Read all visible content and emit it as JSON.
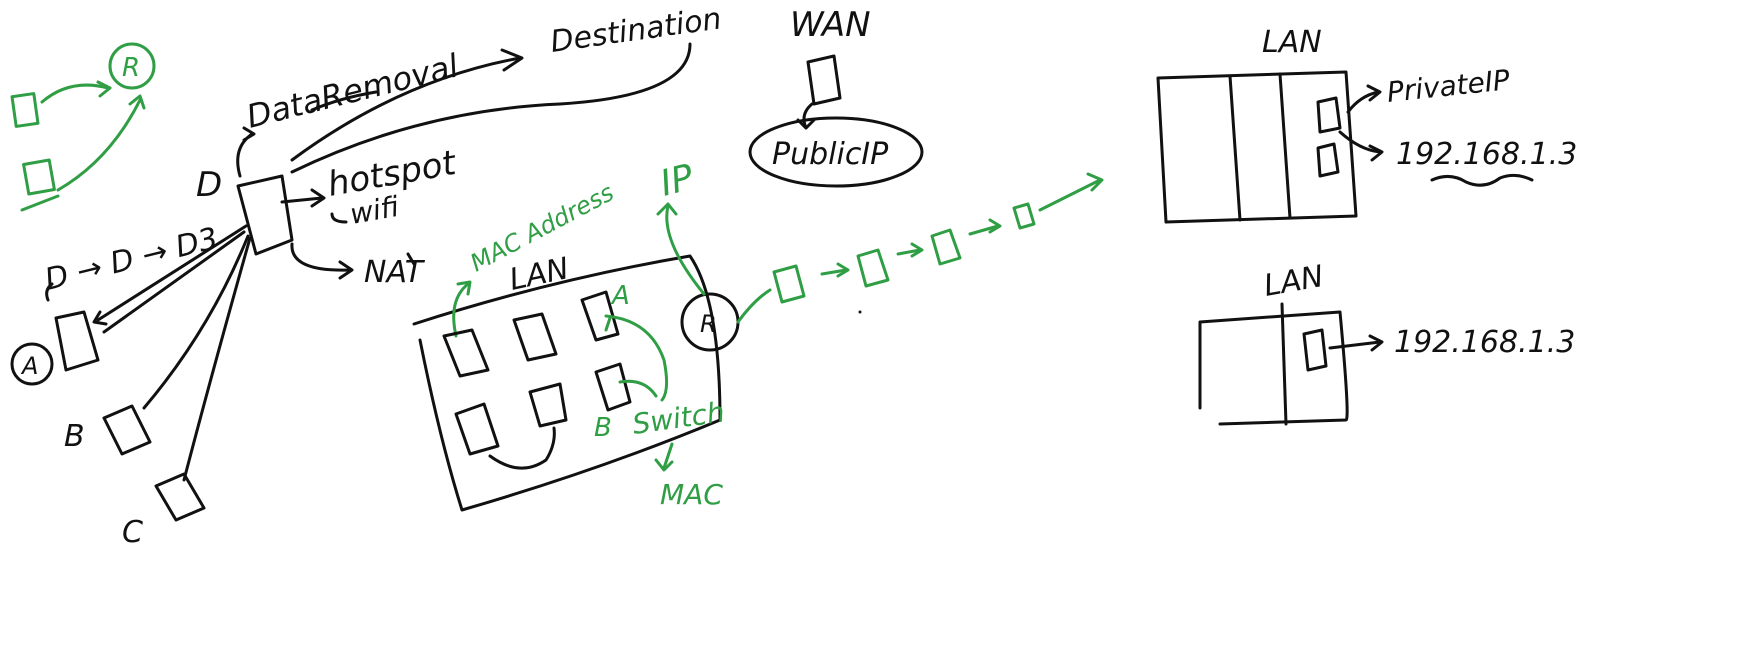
{
  "colors": {
    "black_ink": "#111111",
    "green_ink": "#2f9e44",
    "background": "#ffffff"
  },
  "labels": {
    "r_green": "R",
    "data_removal": "DataRemoval",
    "destination": "Destination",
    "d_top": "D",
    "hotspot": "hotspot",
    "wifi": "wifi",
    "nat": "NAT",
    "d_chain": "D → D → D3",
    "node_a": "A",
    "node_b": "B",
    "node_c": "C",
    "wan": "WAN",
    "public_ip": "PublicIP",
    "ip_green": "IP",
    "mac_address": "MAC Address",
    "lan_mid": "LAN",
    "a_green": "A",
    "b_green": "B",
    "switch": "Switch",
    "mac": "MAC",
    "r_router": "R",
    "lan_right_top": "LAN",
    "private_ip": "PrivateIP",
    "ip_top": "192.168.1.3",
    "lan_right_bottom": "LAN",
    "ip_bottom": "192.168.1.3"
  }
}
